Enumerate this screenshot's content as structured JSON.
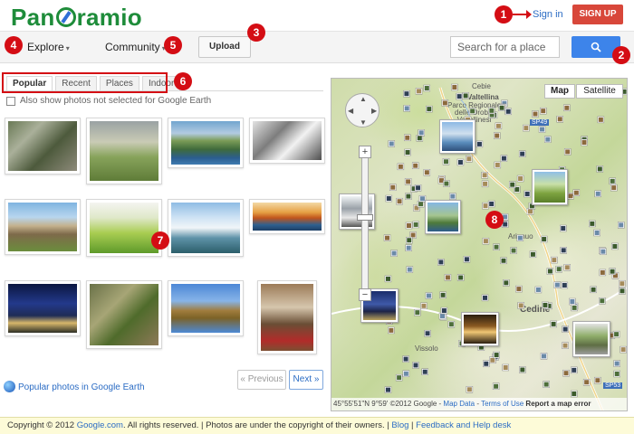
{
  "header": {
    "logo_text": "Panoramio",
    "sign_in": "Sign in",
    "sign_up": "SIGN UP"
  },
  "toolbar": {
    "explore": "Explore",
    "community": "Community",
    "upload": "Upload",
    "search_placeholder": "Search for a place"
  },
  "badges": [
    "1",
    "2",
    "3",
    "4",
    "5",
    "6",
    "7",
    "8"
  ],
  "tabs": [
    "Popular",
    "Recent",
    "Places",
    "Indoor"
  ],
  "active_tab": "Popular",
  "checkbox_label": "Also show photos not selected for Google Earth",
  "google_earth_link": "Popular photos in Google Earth",
  "pager": {
    "previous": "« Previous",
    "next": "Next »"
  },
  "map": {
    "type_map": "Map",
    "type_satellite": "Satellite",
    "labels": {
      "valtellina": "Valtellina",
      "parco": "Parco Regionale\ndelle Orobie\nValtellinesi",
      "sp49": "SP49",
      "sp53": "SP53",
      "cedine": "Cedine",
      "arianuo": "Arianuo",
      "vissolo": "Vissolo",
      "cebie": "Cebie"
    },
    "coords": "45°55'51\"N 9°59'",
    "copyright": "©2012 Google",
    "map_data": "Map Data",
    "terms": "Terms of Use",
    "report": "Report a map error"
  },
  "footer": {
    "copyright": "Copyright © 2012",
    "site": "Google.com",
    "rights": ". All rights reserved. | Photos are under the copyright of their owners. |",
    "blog": "Blog",
    "sep": "|",
    "feedback": "Feedback and Help desk"
  },
  "colors": {
    "brand_green": "#1e8c3a",
    "signup_red": "#d8473a",
    "search_blue": "#3d84ea",
    "badge_red": "#d40d14",
    "link_blue": "#2b6cc4"
  }
}
